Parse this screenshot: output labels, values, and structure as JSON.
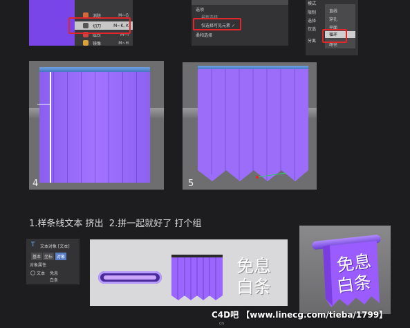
{
  "top_left_menu": {
    "items": [
      {
        "label": "消除",
        "shortcut": "M~G"
      },
      {
        "label": "切刀",
        "shortcut": "M~K, K"
      },
      {
        "label": "磁铁",
        "shortcut": "M~I"
      },
      {
        "label": "镜像",
        "shortcut": "M~H"
      }
    ]
  },
  "top_mid_panel": {
    "section": "选项",
    "row1": "最新选择",
    "row2": "仅选择可见元素",
    "row3": "柔和选择"
  },
  "top_right_dropdown": {
    "labels": [
      "模式",
      "限制",
      "选择",
      "仅选",
      "分离"
    ],
    "items": [
      "直线",
      "穿孔",
      "平面",
      "循环",
      "路径"
    ],
    "selected": "循环"
  },
  "viewports": [
    {
      "number": "4"
    },
    {
      "number": "5"
    }
  ],
  "caption": "1.样条线文本 挤出  2.拼一起就好了 打个组",
  "attr_panel": {
    "title": "文本对象 [文本]",
    "tabs": [
      "基本",
      "坐标",
      "对象"
    ],
    "section": "对象属性",
    "field_label": "文本",
    "field_value_line1": "免息",
    "field_value_line2": "白条"
  },
  "scene_text": {
    "line1": "免息",
    "line2": "白条"
  },
  "final_text": {
    "line1": "免息",
    "line2": "白条"
  },
  "watermark": {
    "text": "C4D吧 【www.linecg.com/tieba/1799】",
    "small": "cn"
  },
  "colors": {
    "purple": "#a070ff",
    "highlight_red": "#e1262c",
    "bar_blue": "#5b8fd8"
  }
}
